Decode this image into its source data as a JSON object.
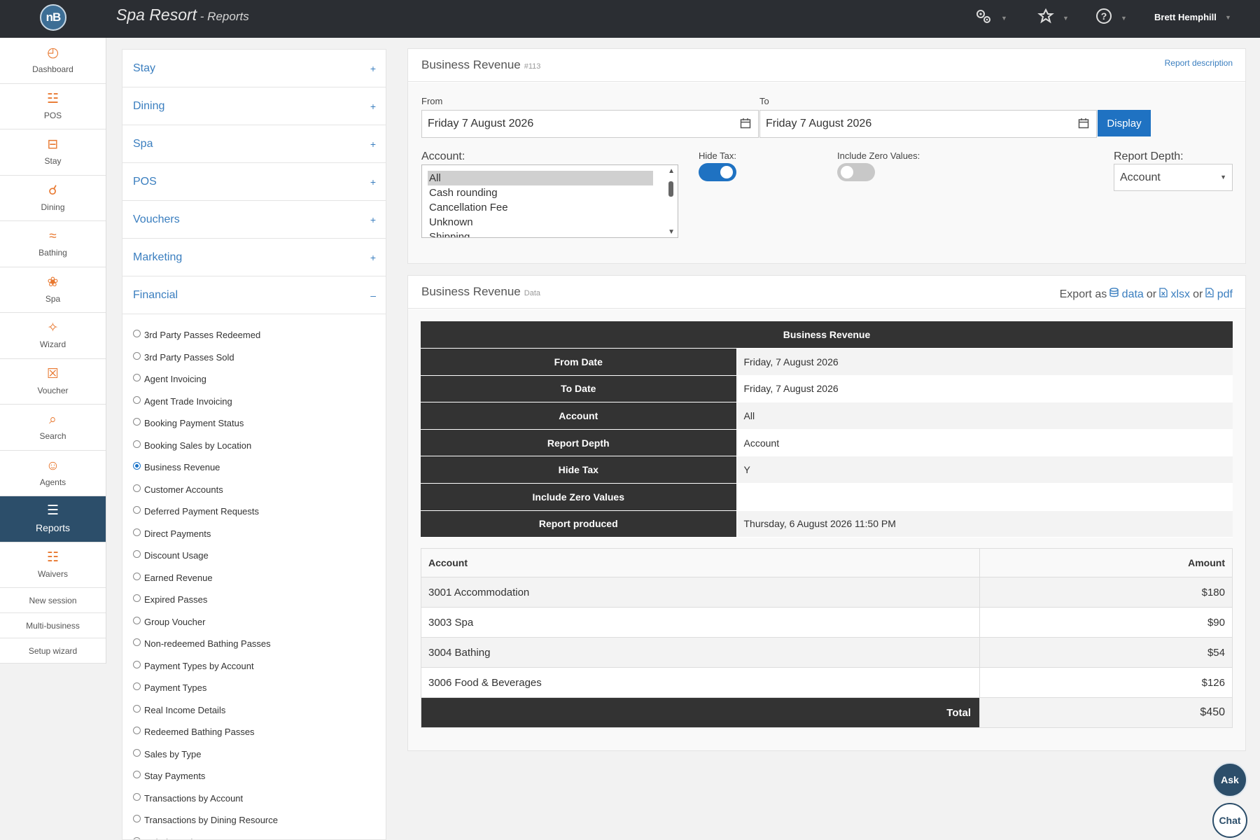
{
  "header": {
    "logo_text": "nB",
    "app_name": "Spa Resort",
    "separator": " - ",
    "section": "Reports",
    "icons": [
      "gears-icon",
      "spa-icon",
      "help-icon"
    ],
    "user": "Brett Hemphill"
  },
  "leftnav": {
    "items": [
      {
        "label": "Dashboard",
        "icon": "dashboard-icon",
        "glyph": "◴"
      },
      {
        "label": "POS",
        "icon": "register-icon",
        "glyph": "☳"
      },
      {
        "label": "Stay",
        "icon": "bed-icon",
        "glyph": "⊟"
      },
      {
        "label": "Dining",
        "icon": "dining-icon",
        "glyph": "☌"
      },
      {
        "label": "Bathing",
        "icon": "waves-icon",
        "glyph": "≈"
      },
      {
        "label": "Spa",
        "icon": "lotus-icon",
        "glyph": "❀"
      },
      {
        "label": "Wizard",
        "icon": "magic-wand-icon",
        "glyph": "✧"
      },
      {
        "label": "Voucher",
        "icon": "gift-icon",
        "glyph": "☒"
      },
      {
        "label": "Search",
        "icon": "search-icon",
        "glyph": "⌕"
      },
      {
        "label": "Agents",
        "icon": "agents-icon",
        "glyph": "☺"
      },
      {
        "label": "Reports",
        "icon": "report-icon",
        "glyph": "☰",
        "active": true
      },
      {
        "label": "Waivers",
        "icon": "checklist-icon",
        "glyph": "☷"
      }
    ],
    "links": [
      "New session",
      "Multi-business",
      "Setup wizard"
    ]
  },
  "categories": {
    "items": [
      {
        "label": "Stay",
        "toggle": "+"
      },
      {
        "label": "Dining",
        "toggle": "+"
      },
      {
        "label": "Spa",
        "toggle": "+"
      },
      {
        "label": "POS",
        "toggle": "+"
      },
      {
        "label": "Vouchers",
        "toggle": "+"
      },
      {
        "label": "Marketing",
        "toggle": "+"
      },
      {
        "label": "Financial",
        "toggle": "–"
      }
    ],
    "financial_reports": [
      "3rd Party Passes Redeemed",
      "3rd Party Passes Sold",
      "Agent Invoicing",
      "Agent Trade Invoicing",
      "Booking Payment Status",
      "Booking Sales by Location",
      "Business Revenue",
      "Customer Accounts",
      "Deferred Payment Requests",
      "Direct Payments",
      "Discount Usage",
      "Earned Revenue",
      "Expired Passes",
      "Group Voucher",
      "Non-redeemed Bathing Passes",
      "Payment Types by Account",
      "Payment Types",
      "Real Income Details",
      "Redeemed Bathing Passes",
      "Sales by Type",
      "Stay Payments",
      "Transactions by Account",
      "Transactions by Dining Resource",
      "Unbalanced Items"
    ],
    "selected_index": 6
  },
  "filter": {
    "title": "Business Revenue",
    "tag": "#113",
    "report_description": "Report description",
    "from_label": "From",
    "from_value": "Friday 7 August 2026",
    "to_label": "To",
    "to_value": "Friday 7 August 2026",
    "display_button": "Display",
    "account_label": "Account:",
    "account_options": [
      "All",
      "Cash rounding",
      "Cancellation Fee",
      "Unknown",
      "Shipping"
    ],
    "hide_tax_label": "Hide Tax:",
    "hide_tax_on": true,
    "include_zero_label": "Include Zero Values:",
    "include_zero_on": false,
    "depth_label": "Report Depth:",
    "depth_value": "Account"
  },
  "data": {
    "title": "Business Revenue",
    "tag": "Data",
    "export_label": "Export as",
    "export_data": "data",
    "export_or": "or",
    "export_xlsx": "xlsx",
    "export_pdf": "pdf",
    "summary_title": "Business Revenue",
    "summary": [
      {
        "key": "From Date",
        "value": "Friday, 7 August 2026"
      },
      {
        "key": "To Date",
        "value": "Friday, 7 August 2026"
      },
      {
        "key": "Account",
        "value": "All"
      },
      {
        "key": "Report Depth",
        "value": "Account"
      },
      {
        "key": "Hide Tax",
        "value": "Y"
      },
      {
        "key": "Include Zero Values",
        "value": ""
      },
      {
        "key": "Report produced",
        "value": "Thursday, 6 August 2026 11:50 PM"
      }
    ],
    "columns": [
      "Account",
      "Amount"
    ],
    "rows": [
      {
        "account": "3001 Accommodation",
        "amount": "$180"
      },
      {
        "account": "3003 Spa",
        "amount": "$90"
      },
      {
        "account": "3004 Bathing",
        "amount": "$54"
      },
      {
        "account": "3006 Food & Beverages",
        "amount": "$126"
      }
    ],
    "total_label": "Total",
    "total_value": "$450"
  },
  "fab": {
    "ask": "Ask",
    "chat": "Chat"
  }
}
